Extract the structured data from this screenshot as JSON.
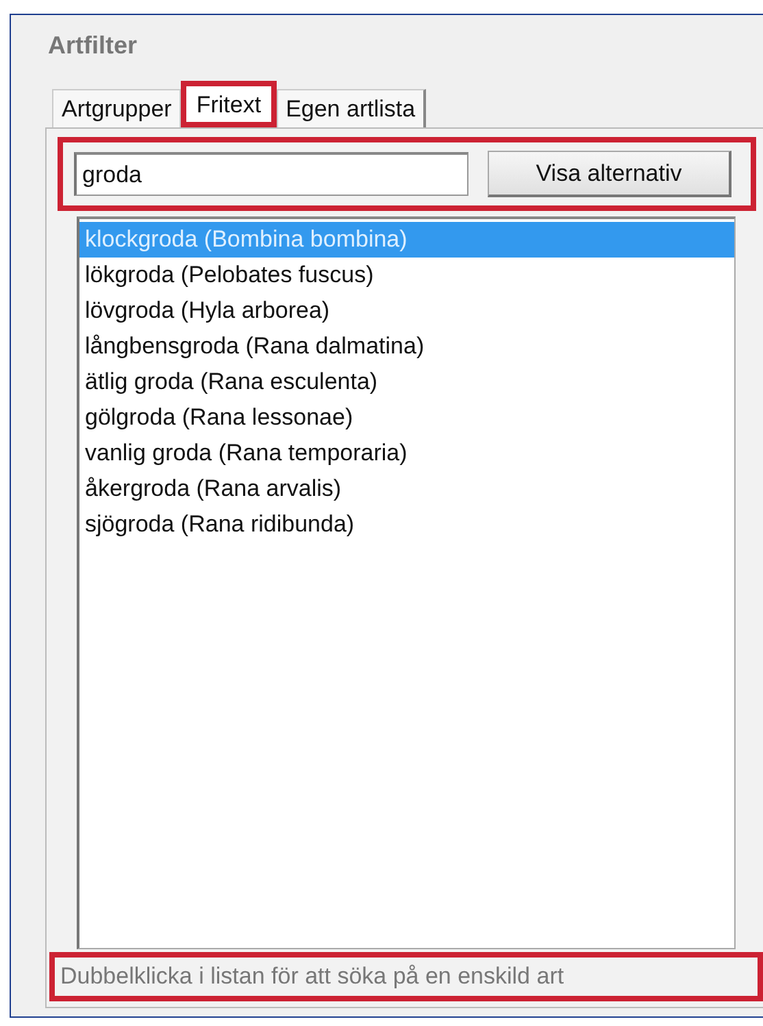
{
  "title": "Artfilter",
  "tabs": [
    {
      "label": "Artgrupper",
      "selected": false,
      "highlighted": false
    },
    {
      "label": "Fritext",
      "selected": true,
      "highlighted": true
    },
    {
      "label": "Egen artlista",
      "selected": false,
      "highlighted": false
    }
  ],
  "search": {
    "value": "groda",
    "button": "Visa alternativ",
    "highlighted": true
  },
  "results": [
    {
      "label": "klockgroda (Bombina bombina)",
      "selected": true
    },
    {
      "label": "lökgroda (Pelobates fuscus)",
      "selected": false
    },
    {
      "label": "lövgroda (Hyla arborea)",
      "selected": false
    },
    {
      "label": "långbensgroda (Rana dalmatina)",
      "selected": false
    },
    {
      "label": "ätlig groda (Rana esculenta)",
      "selected": false
    },
    {
      "label": "gölgroda (Rana lessonae)",
      "selected": false
    },
    {
      "label": "vanlig groda (Rana temporaria)",
      "selected": false
    },
    {
      "label": "åkergroda (Rana arvalis)",
      "selected": false
    },
    {
      "label": "sjögroda (Rana ridibunda)",
      "selected": false
    }
  ],
  "hint": {
    "text": "Dubbelklicka i listan för att söka på en enskild art",
    "highlighted": true
  }
}
